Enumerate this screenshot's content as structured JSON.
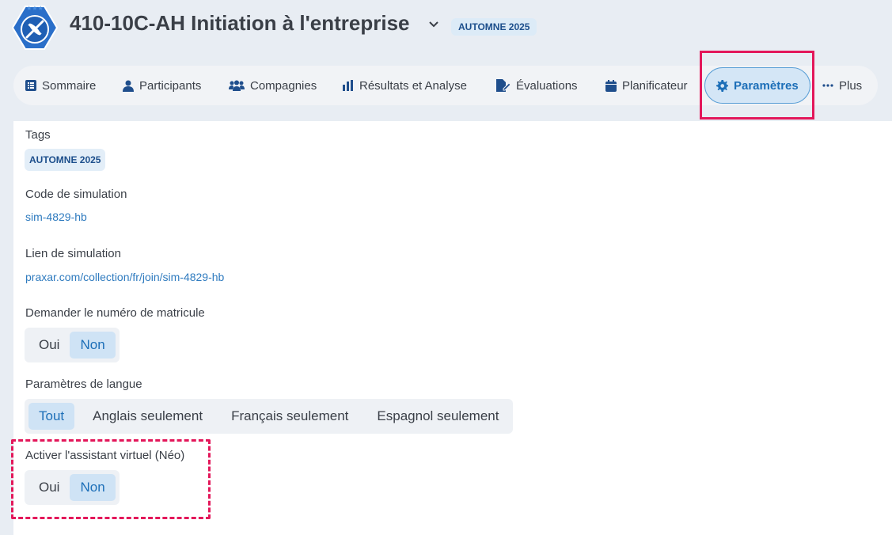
{
  "header": {
    "title": "410-10C-AH Initiation à l'entreprise",
    "tag": "AUTOMNE 2025",
    "logo_icon": "kayak-badge-icon",
    "caret_icon": "chevron-down-icon"
  },
  "nav": {
    "items": [
      {
        "label": "Sommaire",
        "icon": "list-icon"
      },
      {
        "label": "Participants",
        "icon": "user-icon"
      },
      {
        "label": "Compagnies",
        "icon": "users-group-icon"
      },
      {
        "label": "Résultats et Analyse",
        "icon": "bar-chart-icon"
      },
      {
        "label": "Évaluations",
        "icon": "file-edit-icon"
      },
      {
        "label": "Planificateur",
        "icon": "calendar-icon"
      },
      {
        "label": "Paramètres",
        "icon": "gear-icon",
        "active": true
      },
      {
        "label": "Plus",
        "icon": "ellipsis-icon"
      }
    ]
  },
  "settings": {
    "tags_label": "Tags",
    "tags_value": "AUTOMNE 2025",
    "code_label": "Code de simulation",
    "code_value": "sim-4829-hb",
    "link_label": "Lien de simulation",
    "link_value": "praxar.com/collection/fr/join/sim-4829-hb",
    "matricule_label": "Demander le numéro de matricule",
    "matricule_options": [
      "Oui",
      "Non"
    ],
    "matricule_selected": "Non",
    "langue_label": "Paramètres de langue",
    "langue_options": [
      "Tout",
      "Anglais seulement",
      "Français seulement",
      "Espagnol seulement"
    ],
    "langue_selected": "Tout",
    "assistant_label": "Activer l'assistant virtuel (Néo)",
    "assistant_options": [
      "Oui",
      "Non"
    ],
    "assistant_selected": "Non"
  },
  "colors": {
    "accent": "#1d6fb8",
    "highlight": "#e3175a",
    "background": "#e8edf3"
  }
}
